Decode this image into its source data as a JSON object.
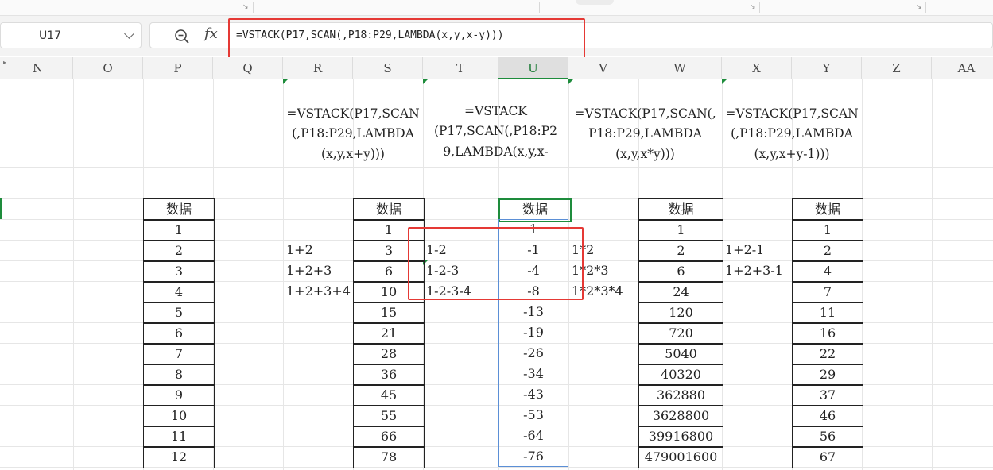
{
  "namebox": {
    "ref": "U17"
  },
  "formula_bar": {
    "fx_label": "fx",
    "formula": "=VSTACK(P17,SCAN(,P18:P29,LAMBDA(x,y,x-y)))"
  },
  "columns": [
    "N",
    "O",
    "P",
    "Q",
    "R",
    "S",
    "T",
    "U",
    "V",
    "W",
    "X",
    "Y",
    "Z",
    "AA"
  ],
  "selected_column": "U",
  "notes": {
    "r": [
      "=VSTACK(P17,SCAN",
      "(,P18:P29,LAMBDA",
      "(x,y,x+y)))"
    ],
    "t": [
      "=VSTACK",
      "(P17,SCAN(,P18:P2",
      "9,LAMBDA(x,y,x-"
    ],
    "v": [
      "=VSTACK(P17,SCAN(,",
      "P18:P29,LAMBDA",
      "(x,y,x*y)))"
    ],
    "x": [
      "=VSTACK(P17,SCAN",
      "(,P18:P29,LAMBDA",
      "(x,y,x+y-1)))"
    ]
  },
  "tables": {
    "p": {
      "header": "数据",
      "values": [
        "1",
        "2",
        "3",
        "4",
        "5",
        "6",
        "7",
        "8",
        "9",
        "10",
        "11",
        "12"
      ]
    },
    "s": {
      "header": "数据",
      "values": [
        "1",
        "3",
        "6",
        "10",
        "15",
        "21",
        "28",
        "36",
        "45",
        "55",
        "66",
        "78"
      ]
    },
    "u": {
      "header": "数据",
      "values": [
        "1",
        "-1",
        "-4",
        "-8",
        "-13",
        "-19",
        "-26",
        "-34",
        "-43",
        "-53",
        "-64",
        "-76"
      ]
    },
    "w": {
      "header": "数据",
      "values": [
        "1",
        "2",
        "6",
        "24",
        "120",
        "720",
        "5040",
        "40320",
        "362880",
        "3628800",
        "39916800",
        "479001600"
      ]
    },
    "y": {
      "header": "数据",
      "values": [
        "1",
        "2",
        "4",
        "7",
        "11",
        "16",
        "22",
        "29",
        "37",
        "46",
        "56",
        "67"
      ]
    }
  },
  "explain": {
    "r": [
      "1+2",
      "1+2+3",
      "1+2+3+4"
    ],
    "t": [
      "1-2",
      "1-2-3",
      "1-2-3-4"
    ],
    "v": [
      "1*2",
      "1*2*3",
      "1*2*3*4"
    ],
    "x": [
      "1+2-1",
      "1+2+3-1"
    ]
  },
  "colors": {
    "selection": "#1e8c3c",
    "highlight": "#e53935"
  }
}
